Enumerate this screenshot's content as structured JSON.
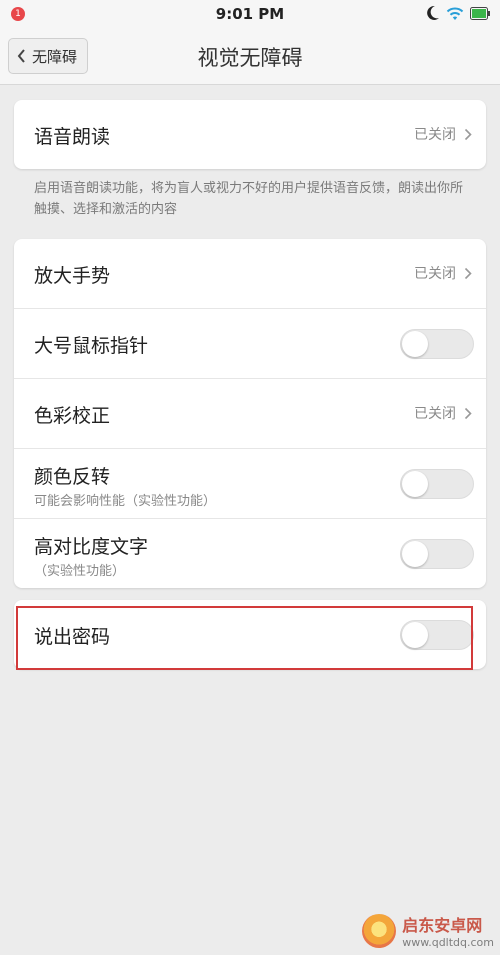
{
  "status_bar": {
    "notification_count": "1",
    "time": "9:01 PM",
    "icons": [
      "moon-icon",
      "wifi-icon",
      "battery-icon"
    ]
  },
  "header": {
    "back_label": "无障碍",
    "title": "视觉无障碍"
  },
  "section_speech": {
    "label": "语音朗读",
    "value": "已关闭",
    "description": "启用语音朗读功能，将为盲人或视力不好的用户提供语音反馈，朗读出你所触摸、选择和激活的内容"
  },
  "section_display": {
    "items": [
      {
        "label": "放大手势",
        "value": "已关闭"
      },
      {
        "label": "大号鼠标指针",
        "toggle": "off"
      },
      {
        "label": "色彩校正",
        "value": "已关闭"
      },
      {
        "label": "颜色反转",
        "sub": "可能会影响性能（实验性功能）",
        "toggle": "off"
      },
      {
        "label": "高对比度文字",
        "sub": "（实验性功能）",
        "toggle": "off"
      }
    ]
  },
  "section_password": {
    "label": "说出密码",
    "toggle": "off"
  },
  "watermark": {
    "title": "启东安卓网",
    "url": "www.qdltdq.com"
  },
  "colors": {
    "background": "#ececec",
    "card": "#ffffff",
    "highlight_border": "#d23a3a",
    "notification_badge": "#e8474a",
    "wifi": "#2a9fd8",
    "battery": "#3bb54a"
  }
}
